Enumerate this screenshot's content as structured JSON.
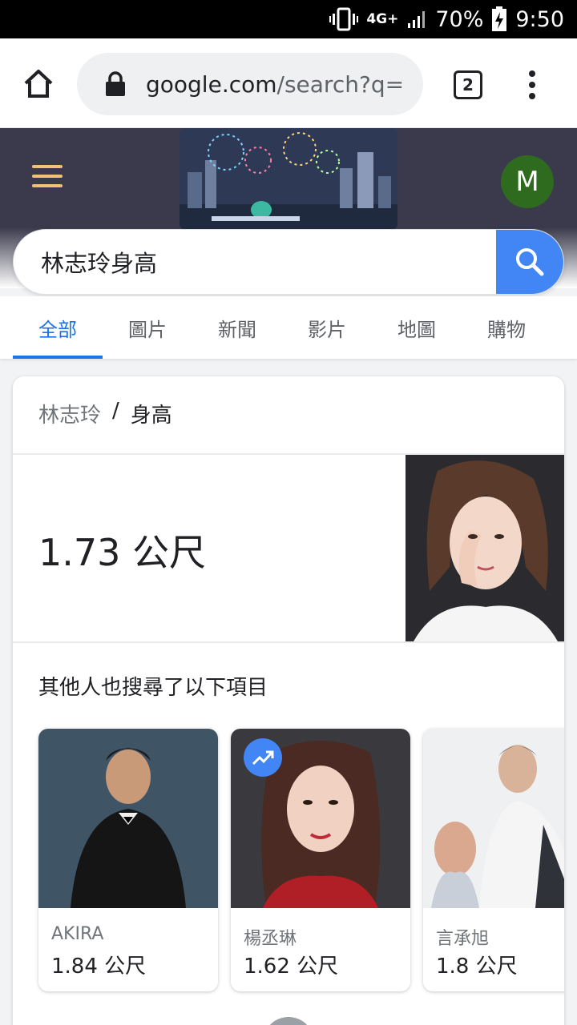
{
  "status_bar": {
    "network": "4G+",
    "battery": "70%",
    "time": "9:50"
  },
  "browser": {
    "url_host": "google.com",
    "url_path": "/search?q=",
    "tab_count": "2"
  },
  "account": {
    "initial": "M"
  },
  "search": {
    "query": "林志玲身高"
  },
  "tabs": [
    {
      "label": "全部",
      "active": true
    },
    {
      "label": "圖片"
    },
    {
      "label": "新聞"
    },
    {
      "label": "影片"
    },
    {
      "label": "地圖"
    },
    {
      "label": "購物"
    }
  ],
  "result": {
    "breadcrumb_subject": "林志玲",
    "breadcrumb_separator": "/",
    "breadcrumb_attribute": "身高",
    "answer": "1.73 公尺",
    "people_also_search_title": "其他人也搜尋了以下項目",
    "people": [
      {
        "name": "AKIRA",
        "value": "1.84 公尺"
      },
      {
        "name": "楊丞琳",
        "value": "1.62 公尺"
      },
      {
        "name": "言承旭",
        "value": "1.8 公尺"
      }
    ]
  },
  "colors": {
    "accent": "#1a73e8",
    "search_button": "#4285f4",
    "avatar": "#2e6b1f",
    "hamburger": "#f0c177",
    "header_bg": "#3a3a4c"
  }
}
